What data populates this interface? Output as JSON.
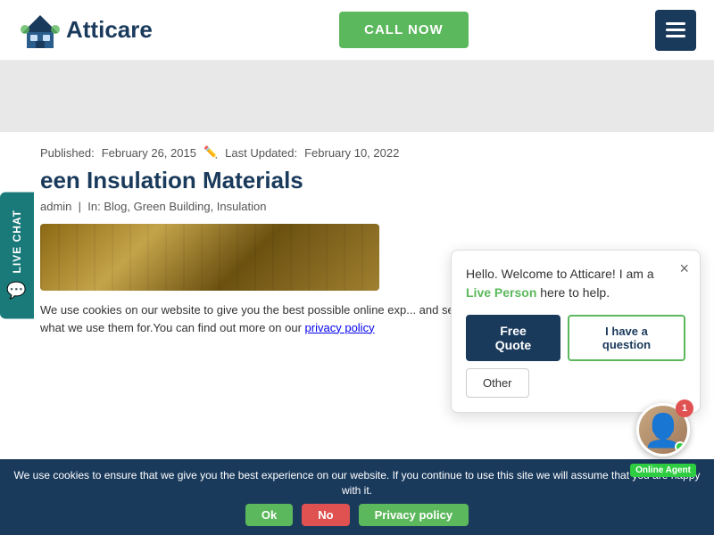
{
  "header": {
    "logo_text": "Atticare",
    "call_now_label": "CALL NOW",
    "hamburger_label": "Menu"
  },
  "live_chat": {
    "label": "LIVE CHAT"
  },
  "article": {
    "published_label": "Published:",
    "published_date": "February 26, 2015",
    "updated_label": "Last Updated:",
    "updated_date": "February 10, 2022",
    "title": "een Insulation Materials",
    "author": "admin",
    "in_label": "In:",
    "tags": "Blog, Green Building, Insulation",
    "excerpt": "We use cookies on our website to give you the best possible online exp... and secure. You can allow all cookies or manage what we use them for.You can find out more on our"
  },
  "privacy_link": "privacy policy",
  "cookie_bar": {
    "message": "We use cookies to ensure that we give you the best experience on our website. If you continue to use this site we will assume that you are happy with it.",
    "ok_label": "Ok",
    "no_label": "No",
    "policy_label": "Privacy policy"
  },
  "chat_popup": {
    "greeting_start": "Hello. Welcome to Atticare! I am a ",
    "live_person": "Live Person",
    "greeting_end": " here to help.",
    "free_quote_label": "Free Quote",
    "question_label": "I have a question",
    "other_label": "Other"
  },
  "agent": {
    "badge_count": "1",
    "status_label": "Online Agent"
  }
}
